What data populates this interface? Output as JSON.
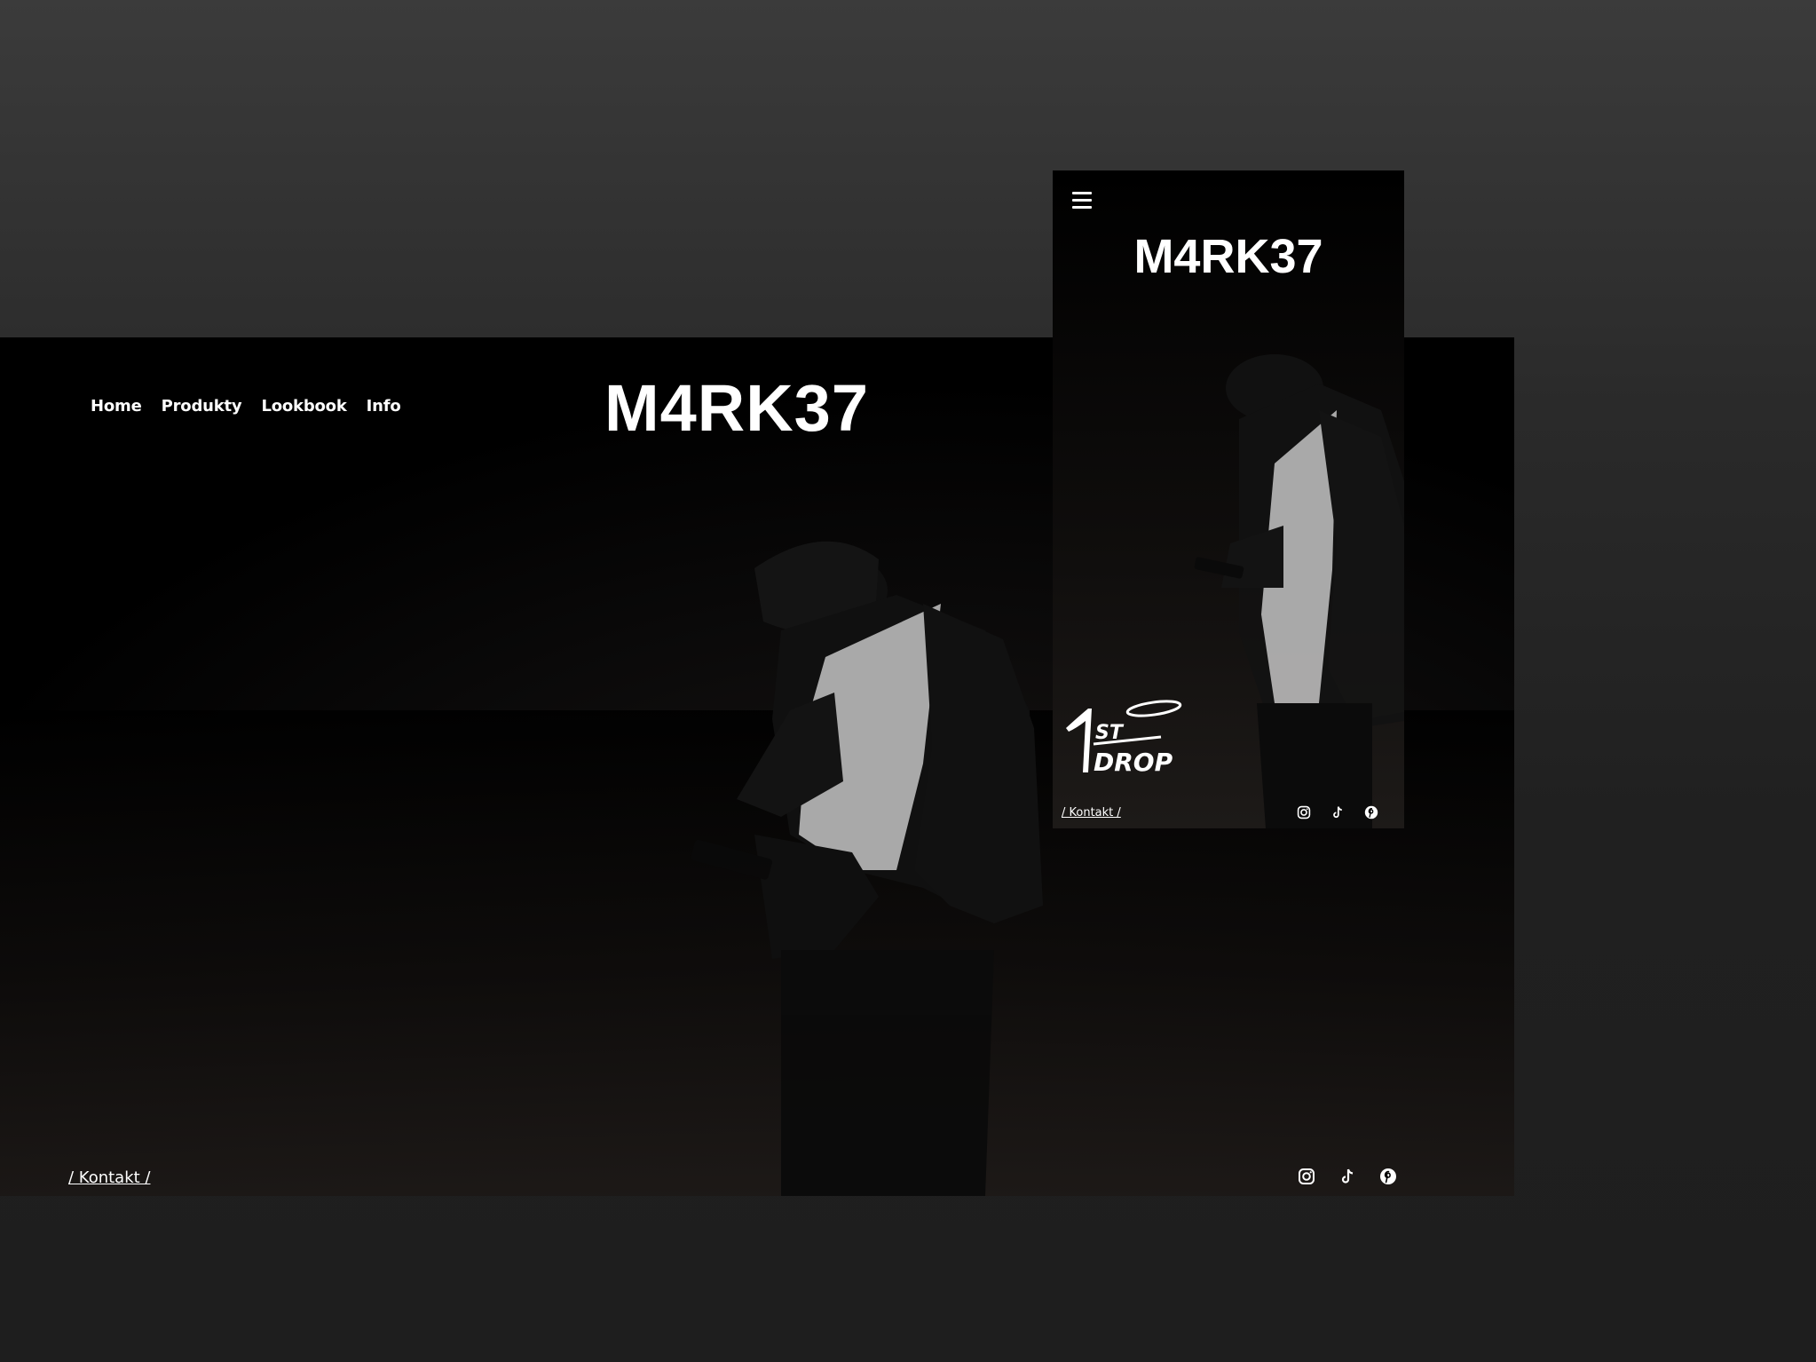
{
  "desktop": {
    "brand": "M4RK37",
    "nav": [
      "Home",
      "Produkty",
      "Lookbook",
      "Info"
    ],
    "footer_link": "/ Kontakt /",
    "social_icons": [
      "instagram-icon",
      "tiktok-icon",
      "pinterest-icon"
    ]
  },
  "mobile": {
    "menu_icon": "hamburger-menu-icon",
    "brand": "M4RK37",
    "logo_text": "1ST DROP",
    "footer_link": "/ Kontakt /",
    "social_icons": [
      "instagram-icon",
      "tiktok-icon",
      "pinterest-icon"
    ]
  },
  "colors": {
    "background": "#2b2b2b",
    "screen": "#000000",
    "text": "#ffffff"
  }
}
